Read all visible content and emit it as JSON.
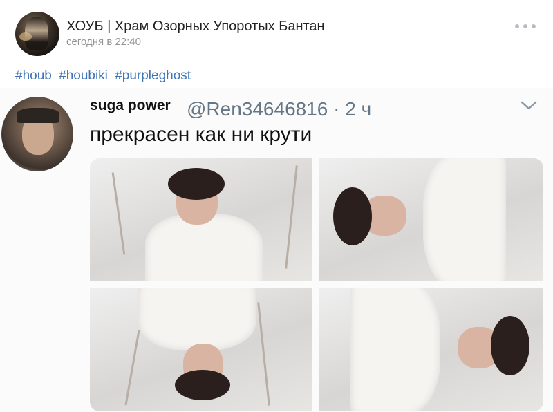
{
  "post": {
    "group_name": "ХОУБ | Храм Озорных Упоротых Бантан",
    "time": "сегодня в 22:40",
    "hashtags": [
      "#houb",
      "#houbiki",
      "#purpleghost"
    ]
  },
  "tweet": {
    "display_name": "suga power",
    "handle_time": "@Ren34646816 · 2 ч",
    "text": "прекрасен как ни крути"
  },
  "icons": {
    "more": "more-dots-icon",
    "chevron": "chevron-down-icon"
  },
  "colors": {
    "link": "#3f73b6",
    "muted": "#939393",
    "handle": "#657786"
  }
}
